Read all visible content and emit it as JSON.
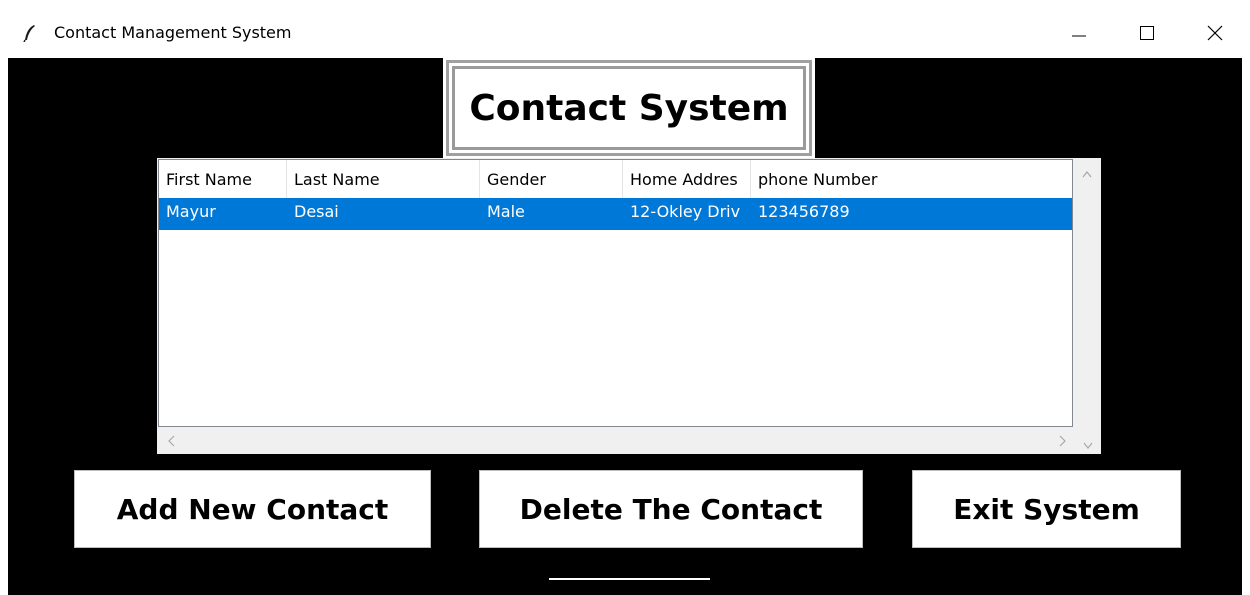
{
  "window": {
    "title": "Contact Management System",
    "icon": "feather-icon",
    "controls": [
      "minimize-icon",
      "maximize-icon",
      "close-icon"
    ]
  },
  "heading": "Contact System",
  "table": {
    "columns": [
      "First Name",
      "Last Name",
      "Gender",
      "Home Addres",
      "phone Number"
    ],
    "rows": [
      {
        "first_name": "Mayur",
        "last_name": "Desai",
        "gender": "Male",
        "home_address": "12-Okley Driv",
        "phone": "123456789",
        "selected": true
      }
    ]
  },
  "buttons": {
    "add": "Add New Contact",
    "delete": "Delete The Contact",
    "exit": "Exit System"
  },
  "colors": {
    "background": "#000000",
    "selection": "#0078d7"
  }
}
